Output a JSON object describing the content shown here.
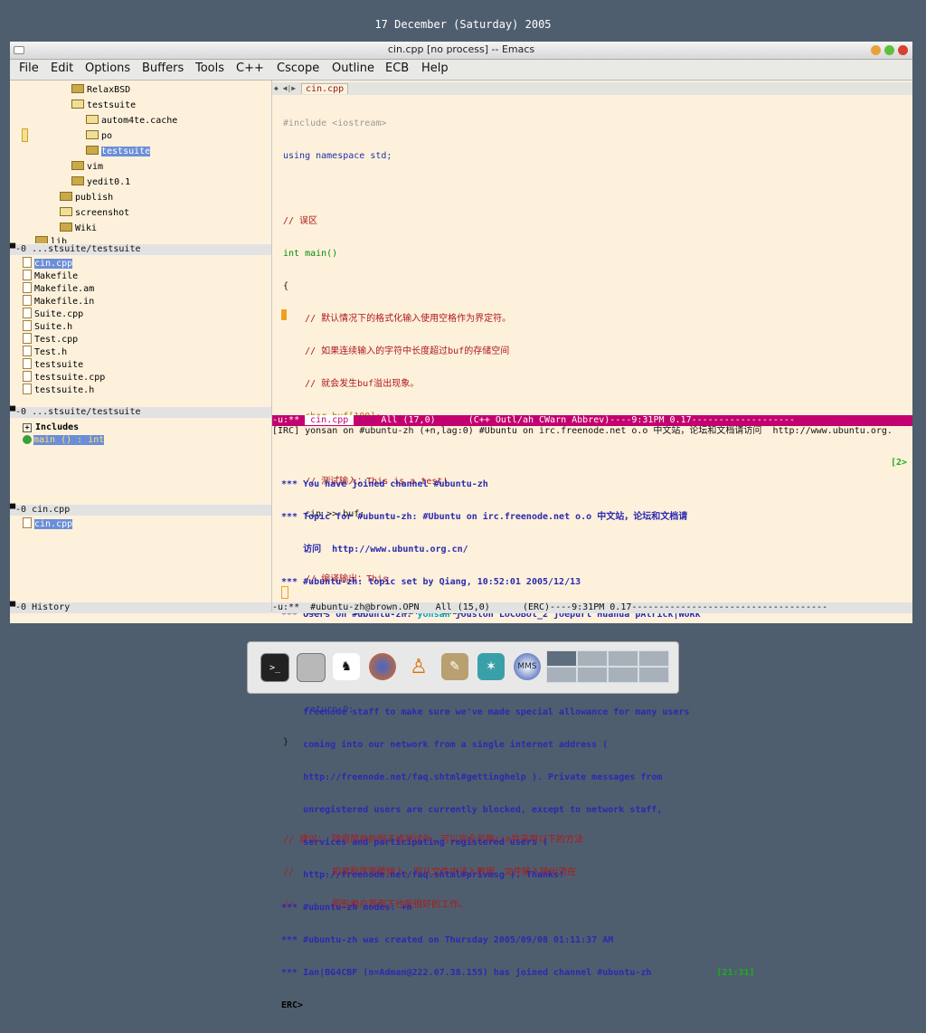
{
  "desktop": {
    "date": "17 December (Saturday) 2005"
  },
  "window": {
    "title": "cin.cpp [no process] -- Emacs"
  },
  "menu": [
    "File",
    "Edit",
    "Options",
    "Buffers",
    "Tools",
    "C++",
    "Cscope",
    "Outline",
    "ECB",
    "Help"
  ],
  "directories": {
    "items": [
      "RelaxBSD",
      "testsuite",
      "autom4te.cache",
      "po",
      "testsuite",
      "vim",
      "yedit0.1",
      "publish",
      "screenshot",
      "Wiki",
      "lib"
    ],
    "modeline": "▀-0 ...stsuite/testsuite"
  },
  "sources": {
    "items": [
      "cin.cpp",
      "Makefile",
      "Makefile.am",
      "Makefile.in",
      "Suite.cpp",
      "Suite.h",
      "Test.cpp",
      "Test.h",
      "testsuite",
      "testsuite.cpp",
      "testsuite.h"
    ],
    "modeline": "▀-0 ...stsuite/testsuite"
  },
  "methods": {
    "group": "Includes",
    "item": "main () : int",
    "modeline": "▀-0 cin.cpp"
  },
  "history": {
    "items": [
      "cin.cpp"
    ],
    "modeline": "▀-0 History"
  },
  "editor": {
    "tab": "cin.cpp",
    "lines": [
      "#include <iostream>",
      "using namespace std;",
      "",
      "// 误区",
      "int main()",
      "{",
      "    // 默认情况下的格式化输入使用空格作为界定符。",
      "    // 如果连续输入的字符中长度超过buf的存储空间",
      "    // 就会发生buf溢出现象。",
      "    char buf[100];",
      "",
      "    // 测试输入：This is a test!",
      "    cin >> buf;",
      "",
      "    // 编译输出：This",
      "    cout << \"buf=\" << buf << endl;",
      "",
      "    cout << flush;",
      "    return 0;",
      "}",
      "",
      "",
      "// 建议： 除很简单的例子或测试外，可以完全忽略cin并采用以下的方法",
      "//       如果程序需要输入，则从文件中读入数据。文件输入输出流在",
      "//       图形用户界面下也能很好的工作。"
    ],
    "modeline_prefix": "-u:** ",
    "modeline_buffer": " cin.cpp ",
    "modeline_rest": "     All (17,0)      (C++ Outl/ah CWarn Abbrev)----9:31PM 0.17-------------------"
  },
  "irc": {
    "header": "[IRC] yonsan on #ubuntu-zh (+n,lag:0) #Ubuntu on irc.freenode.net o.o 中文站，论坛和文档请访问  http://www.ubuntu.org.",
    "channel_num": "[2>",
    "lines": [
      "*** You have joined channel #ubuntu-zh",
      "*** Topic for #ubuntu-zh: #Ubuntu on irc.freenode.net o.o 中文站，论坛和文档请",
      "    访问  http://www.ubuntu.org.cn/",
      "*** #ubuntu-zh: topic set by Qiang, 10:52:01 2005/12/13",
      "*** Users on #ubuntu-zh: ",
      "    Qiang",
      "*** #ubuntu-zh: [freenode-info] If you're at a conference, please contact",
      "    freenode staff to make sure we've made special allowance for many users",
      "    coming into our network from a single internet address (",
      "    http://freenode.net/faq.shtml#gettinghelp ). Private messages from",
      "    unregistered users are currently blocked, except to network staff,",
      "    services and participating registered users (",
      "    http://freenode.net/faq.shtml#privmsg ). Thanks!",
      "*** #ubuntu-zh modes: +n",
      "*** #ubuntu-zh was created on Thursday 2005/09/08 01:11:37 AM",
      "*** Ian|BG4CBF (n=Adman@222.67.38.155) has joined channel #ubuntu-zh"
    ],
    "users_nick": "yonsan",
    "users_rest": " jouston LoCoBot_2 joepurl Huahua pAtrick|WoRk",
    "join_time": "[21:31]",
    "prompt": "ERC>",
    "modeline": "-u:**  #ubuntu-zh@brown.OPN   All (15,0)      (ERC)----9:31PM 0.17------------------------------------"
  },
  "dock": {
    "icons": [
      "terminal-icon",
      "drive-icon",
      "gnu-icon",
      "firefox-icon",
      "person-icon",
      "gimp-icon",
      "network-icon",
      "mms-icon"
    ]
  }
}
